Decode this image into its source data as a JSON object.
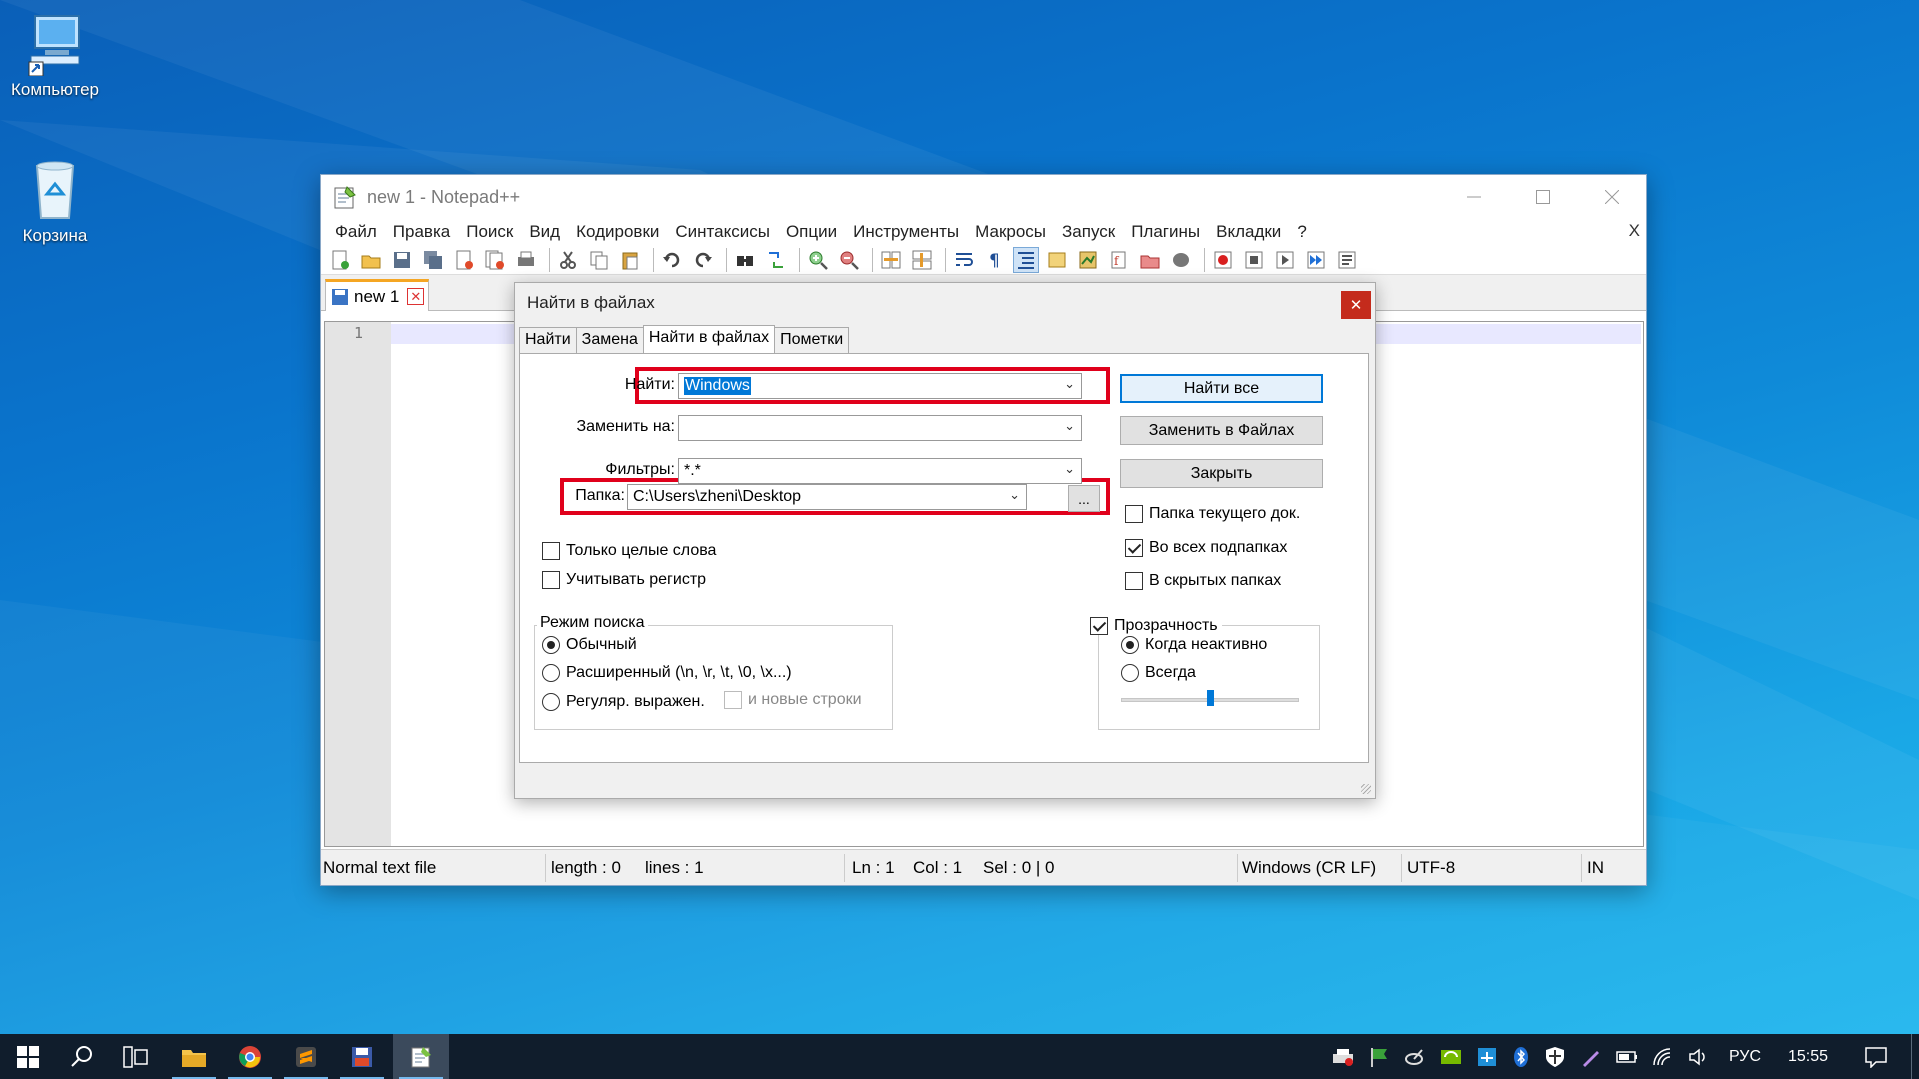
{
  "desktop": {
    "icons": [
      {
        "label": "Компьютер"
      },
      {
        "label": "Корзина"
      }
    ]
  },
  "window": {
    "title": "new 1 - Notepad++",
    "menu": [
      "Файл",
      "Правка",
      "Поиск",
      "Вид",
      "Кодировки",
      "Синтаксисы",
      "Опции",
      "Инструменты",
      "Макросы",
      "Запуск",
      "Плагины",
      "Вкладки",
      "?"
    ],
    "menu_close": "X",
    "tab_label": "new 1",
    "tab_close": "✕",
    "line_number": "1"
  },
  "status": {
    "type": "Normal text file",
    "length": "length : 0",
    "lines": "lines : 1",
    "ln": "Ln : 1",
    "col": "Col : 1",
    "sel": "Sel : 0 | 0",
    "eol": "Windows (CR LF)",
    "encoding": "UTF-8",
    "mode": "IN"
  },
  "dialog": {
    "title": "Найти в файлах",
    "close": "✕",
    "tabs": [
      "Найти",
      "Замена",
      "Найти в файлах",
      "Пометки"
    ],
    "active_tab": 2,
    "find_label": "Найти:",
    "find_value": "Windows",
    "replace_label": "Заменить на:",
    "replace_value": "",
    "filters_label": "Фильтры:",
    "filters_value": "*.*",
    "folder_label": "Папка:",
    "folder_value": "C:\\Users\\zheni\\Desktop",
    "browse": "...",
    "buttons": {
      "find_all": "Найти все",
      "replace_in_files": "Заменить в Файлах",
      "close": "Закрыть"
    },
    "checks": {
      "current_doc_folder": {
        "label": "Папка текущего док.",
        "checked": false
      },
      "all_subfolders": {
        "label": "Во всех подпапках",
        "checked": true
      },
      "hidden_folders": {
        "label": "В скрытых папках",
        "checked": false
      },
      "whole_words": {
        "label": "Только целые слова",
        "checked": false
      },
      "match_case": {
        "label": "Учитывать регистр",
        "checked": false
      }
    },
    "search_mode": {
      "title": "Режим поиска",
      "normal": "Обычный",
      "extended": "Расширенный (\\n, \\r, \\t, \\0, \\x...)",
      "regex": "Регуляр. выражен.",
      "newlines": "и новые строки",
      "selected": "normal"
    },
    "transparency": {
      "label": "Прозрачность",
      "checked": true,
      "on_inactive": "Когда неактивно",
      "always": "Всегда",
      "selected": "on_inactive",
      "level": 0.5
    }
  },
  "taskbar": {
    "language": "РУС",
    "time": "15:55"
  },
  "colors": {
    "highlight": "#e0001b",
    "accent": "#0078d7",
    "taskbar": "#101d2c"
  }
}
